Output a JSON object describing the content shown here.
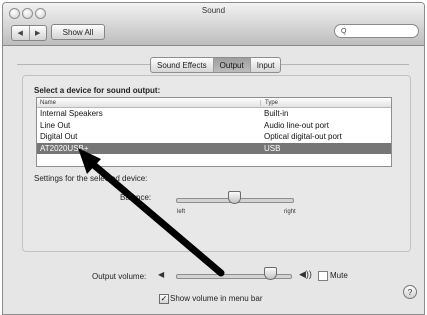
{
  "window": {
    "title": "Sound"
  },
  "toolbar": {
    "back": "◀",
    "forward": "▶",
    "show_all": "Show All",
    "search_icon": "Q",
    "search_placeholder": ""
  },
  "tabs": [
    {
      "label": "Sound Effects",
      "active": false
    },
    {
      "label": "Output",
      "active": true
    },
    {
      "label": "Input",
      "active": false
    }
  ],
  "output": {
    "select_label": "Select a device for sound output:",
    "columns": [
      "Name",
      "Type"
    ],
    "devices": [
      {
        "name": "Internal Speakers",
        "type": "Built-in",
        "selected": false
      },
      {
        "name": "Line Out",
        "type": "Audio line-out port",
        "selected": false
      },
      {
        "name": "Digital Out",
        "type": "Optical digital-out port",
        "selected": false
      },
      {
        "name": "AT2020USB+",
        "type": "USB",
        "selected": true
      }
    ],
    "settings_label": "Settings for the selected device:",
    "balance_label": "Balance:",
    "balance_left": "left",
    "balance_right": "right",
    "balance_value": 0.5
  },
  "help_icon": "?",
  "footer": {
    "output_volume_label": "Output volume:",
    "volume_value": 0.8,
    "mute_label": "Mute",
    "mute_checked": false,
    "show_volume_label": "Show volume in menu bar",
    "show_volume_checked": true
  },
  "colors": {
    "selected_row": "#767676",
    "background": "#e6e6e6"
  }
}
